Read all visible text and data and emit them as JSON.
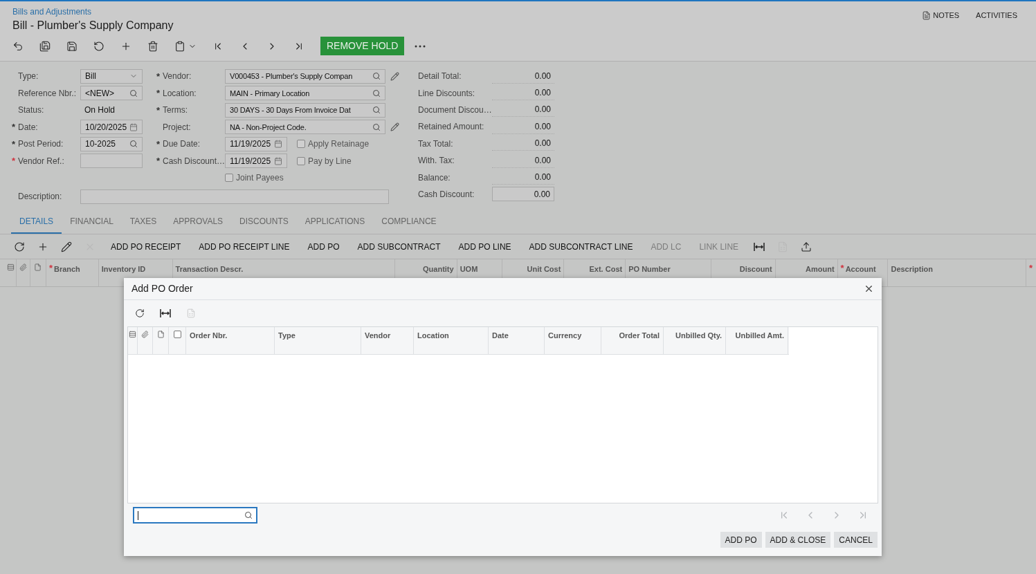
{
  "breadcrumb": "Bills and Adjustments",
  "title": "Bill - Plumber's Supply Company",
  "top_links": [
    {
      "label": "NOTES",
      "kind": "notes"
    },
    {
      "label": "ACTIVITIES",
      "kind": "plain"
    }
  ],
  "toolbar": [
    {
      "kind": "back"
    },
    {
      "kind": "save-close"
    },
    {
      "kind": "save"
    },
    {
      "kind": "undo"
    },
    {
      "kind": "add"
    },
    {
      "kind": "delete"
    },
    {
      "kind": "copy"
    },
    {
      "kind": "first"
    },
    {
      "kind": "prev"
    },
    {
      "kind": "next"
    },
    {
      "kind": "last"
    }
  ],
  "primary_action": "REMOVE HOLD",
  "left_fields": [
    {
      "label": "Type:",
      "kind": "select",
      "value": "Bill"
    },
    {
      "label": "Reference Nbr.:",
      "kind": "lookup",
      "value": "<NEW>"
    },
    {
      "label": "Status:",
      "kind": "text",
      "value": "On Hold"
    },
    {
      "label": "Date:",
      "mark": "*",
      "invalid": false,
      "kind": "date",
      "value": "10/20/2025"
    },
    {
      "label": "Post Period:",
      "mark": "*",
      "invalid": false,
      "kind": "lookup",
      "value": "10-2025"
    },
    {
      "label": "Vendor Ref.:",
      "mark": "*",
      "invalid": true,
      "kind": "input"
    }
  ],
  "middle_fields": [
    {
      "label": "Vendor:",
      "mark": "*",
      "kind": "lookup",
      "value": "V000453 - Plumber's Supply Compan",
      "editable": true
    },
    {
      "label": "Location:",
      "mark": "*",
      "kind": "lookup",
      "value": "MAIN - Primary Location",
      "editable": false
    },
    {
      "label": "Terms:",
      "mark": "*",
      "kind": "lookup",
      "value": "30 DAYS - 30 Days From Invoice Dat",
      "editable": false
    },
    {
      "label": "Project:",
      "kind": "lookup",
      "value": "NA - Non-Project Code.",
      "editable": true
    },
    {
      "label": "Due Date:",
      "mark": "*",
      "kind": "date",
      "value": "11/19/2025",
      "checkbox": {
        "label": "Apply Retainage",
        "checked": false
      }
    },
    {
      "label": "Cash Discount…",
      "mark": "*",
      "kind": "date",
      "value": "11/19/2025",
      "checkbox": {
        "label": "Pay by Line",
        "checked": false
      }
    },
    {
      "kind": "checkbox",
      "checkbox": {
        "label": "Joint Payees",
        "checked": false
      }
    }
  ],
  "description_label": "Description:",
  "totals": [
    {
      "label": "Detail Total:",
      "value": "0.00",
      "kind": "readonly"
    },
    {
      "label": "Line Discounts:",
      "value": "0.00",
      "kind": "readonly"
    },
    {
      "label": "Document Discou…",
      "value": "0.00",
      "kind": "readonly"
    },
    {
      "label": "Retained Amount:",
      "value": "0.00",
      "kind": "readonly"
    },
    {
      "label": "Tax Total:",
      "value": "0.00",
      "kind": "readonly"
    },
    {
      "label": "With. Tax:",
      "value": "0.00",
      "kind": "readonly"
    },
    {
      "label": "Balance:",
      "value": "0.00",
      "kind": "readonly"
    },
    {
      "label": "Cash Discount:",
      "value": "0.00",
      "kind": "input"
    }
  ],
  "tabs": [
    {
      "label": "DETAILS",
      "selected": true
    },
    {
      "label": "FINANCIAL",
      "selected": false
    },
    {
      "label": "TAXES",
      "selected": false
    },
    {
      "label": "APPROVALS",
      "selected": false
    },
    {
      "label": "DISCOUNTS",
      "selected": false
    },
    {
      "label": "APPLICATIONS",
      "selected": false
    },
    {
      "label": "COMPLIANCE",
      "selected": false
    }
  ],
  "grid_toolbar": [
    {
      "kind": "refresh",
      "disabled": false
    },
    {
      "kind": "add",
      "disabled": false
    },
    {
      "kind": "edit",
      "disabled": false
    },
    {
      "kind": "remove",
      "disabled": true
    },
    {
      "kind": "text",
      "label": "ADD PO RECEIPT",
      "disabled": false
    },
    {
      "kind": "text",
      "label": "ADD PO RECEIPT LINE",
      "disabled": false
    },
    {
      "kind": "text",
      "label": "ADD PO",
      "disabled": false
    },
    {
      "kind": "text",
      "label": "ADD SUBCONTRACT",
      "disabled": false
    },
    {
      "kind": "text",
      "label": "ADD PO LINE",
      "disabled": false
    },
    {
      "kind": "text",
      "label": "ADD SUBCONTRACT LINE",
      "disabled": false
    },
    {
      "kind": "text",
      "label": "ADD LC",
      "disabled": true
    },
    {
      "kind": "text",
      "label": "LINK LINE",
      "disabled": true
    },
    {
      "kind": "fit",
      "disabled": false
    },
    {
      "kind": "excel",
      "disabled": true
    },
    {
      "kind": "upload",
      "disabled": false
    }
  ],
  "grid_columns": [
    {
      "label": "Branch",
      "mark": "*"
    },
    {
      "label": "Inventory ID"
    },
    {
      "label": "Transaction Descr."
    },
    {
      "label": "Quantity"
    },
    {
      "label": "UOM"
    },
    {
      "label": "Unit Cost"
    },
    {
      "label": "Ext. Cost"
    },
    {
      "label": "PO Number"
    },
    {
      "label": "Discount"
    },
    {
      "label": "Amount"
    },
    {
      "label": "Account",
      "mark": "*"
    },
    {
      "label": "Description"
    },
    {
      "mark": "*"
    }
  ],
  "dialog": {
    "title": "Add PO Order",
    "toolbar": [
      {
        "kind": "refresh",
        "disabled": false
      },
      {
        "kind": "fit",
        "disabled": false
      },
      {
        "kind": "excel",
        "disabled": true
      }
    ],
    "columns": [
      "Order Nbr.",
      "Type",
      "Vendor",
      "Location",
      "Date",
      "Currency",
      "Order Total",
      "Unbilled Qty.",
      "Unbilled Amt."
    ],
    "select_all_checked": false,
    "search_focused": true,
    "buttons": [
      "ADD PO",
      "ADD & CLOSE",
      "CANCEL"
    ]
  }
}
